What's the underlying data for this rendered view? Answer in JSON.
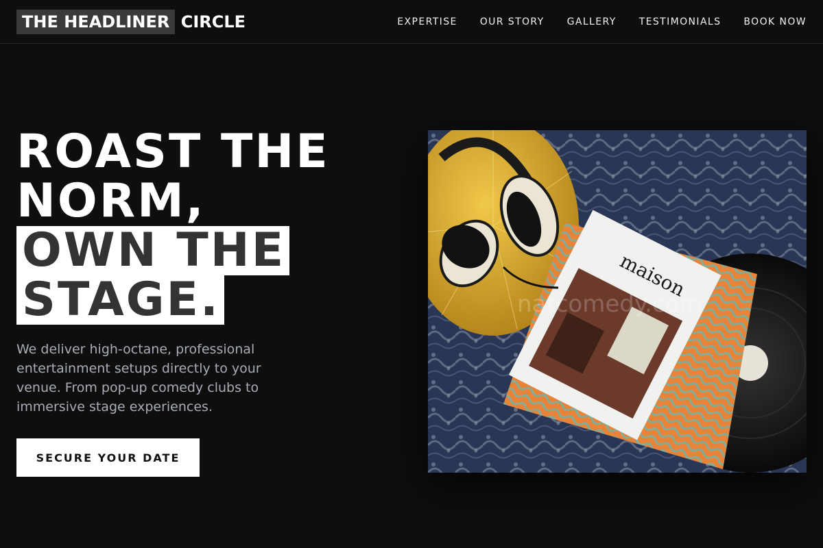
{
  "brand": {
    "highlight": "THE HEADLINER",
    "rest": " CIRCLE"
  },
  "nav": {
    "items": [
      "EXPERTISE",
      "OUR STORY",
      "GALLERY",
      "TESTIMONIALS",
      "BOOK NOW"
    ]
  },
  "hero": {
    "title_line1": "ROAST THE",
    "title_line2": "NORM,",
    "title_hl_line1": "OWN THE",
    "title_hl_line2": "STAGE.",
    "description": "We deliver high-octane, professional entertainment setups directly to your venue. From pop-up comedy clubs to immersive stage experiences.",
    "cta_label": "SECURE YOUR DATE"
  },
  "image": {
    "magazine_title": "maison",
    "watermark": "natcomedy.com",
    "colors": {
      "rug": "#2a3656",
      "pillow": "#d9aa2a",
      "record_sleeve": "#e8833a",
      "vinyl": "#111111"
    }
  },
  "colors": {
    "background": "#0e0e0f",
    "text": "#ffffff",
    "muted_text": "#a9adb5",
    "brand_highlight": "#3a3a3d"
  }
}
